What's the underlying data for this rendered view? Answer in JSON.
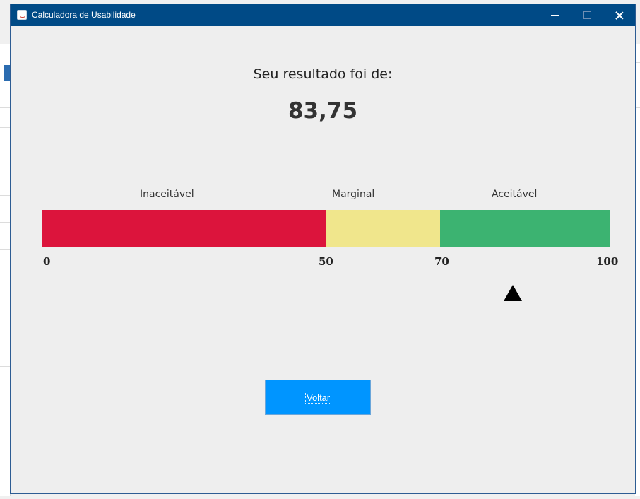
{
  "window": {
    "title": "Calculadora de Usabilidade"
  },
  "result": {
    "heading": "Seu resultado foi de:",
    "score": "83,75",
    "score_value": 83.75
  },
  "scale": {
    "zones": [
      {
        "label": "Inaceitável",
        "from": 0,
        "to": 50,
        "color": "#dc143c"
      },
      {
        "label": "Marginal",
        "from": 50,
        "to": 70,
        "color": "#f0e68c"
      },
      {
        "label": "Aceitável",
        "from": 70,
        "to": 100,
        "color": "#3cb371"
      }
    ],
    "ticks": [
      "0",
      "50",
      "70",
      "100"
    ]
  },
  "actions": {
    "back_label": "Voltar"
  },
  "colors": {
    "titlebar": "#004a86",
    "button": "#0095ff",
    "marker": "#000000"
  }
}
